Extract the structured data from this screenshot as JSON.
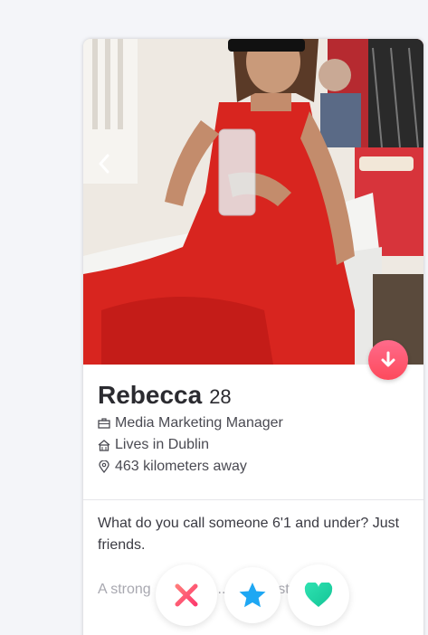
{
  "profile": {
    "name": "Rebecca",
    "age": "28",
    "job": "Media Marketing Manager",
    "location": "Lives in Dublin",
    "distance": "463 kilometers away",
    "bio_line1": "What do you call someone 6'1 and under? Just friends.",
    "bio_line2": "A strong  ... s f  ... l  ... one must be taller"
  },
  "icons": {
    "back": "chevron-left-icon",
    "down": "arrow-down-icon",
    "job": "briefcase-icon",
    "location": "home-icon",
    "distance": "location-pin-icon",
    "nope": "x-icon",
    "super_like": "star-icon",
    "like": "heart-icon"
  },
  "colors": {
    "down_button": "#fd5068",
    "nope": "#fd5068",
    "star": "#1ea7f3",
    "like": "#1ee0a3"
  }
}
